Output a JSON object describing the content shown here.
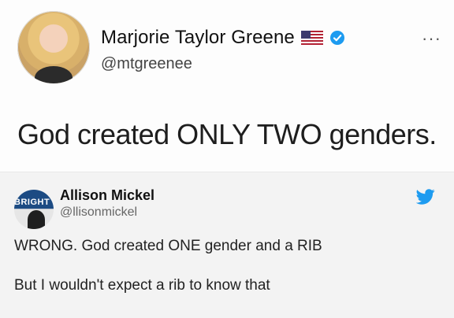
{
  "tweet": {
    "author_name": "Marjorie Taylor Greene",
    "author_handle": "@mtgreenee",
    "more_label": "···",
    "text": "God created ONLY TWO genders."
  },
  "reply": {
    "avatar_badge": "BRIGHT",
    "author_name": "Allison Mickel",
    "author_handle": "@llisonmickel",
    "line1": "WRONG. God created ONE gender and a RIB",
    "line2": "But I wouldn't expect a rib to know that"
  },
  "icons": {
    "flag": "us-flag-icon",
    "verified": "verified-badge-icon",
    "bird": "twitter-bird-icon"
  },
  "colors": {
    "verified": "#1d9bf0",
    "twitter_blue": "#1d9bf0",
    "flag_red": "#b22234",
    "flag_blue": "#3c3b6e"
  }
}
